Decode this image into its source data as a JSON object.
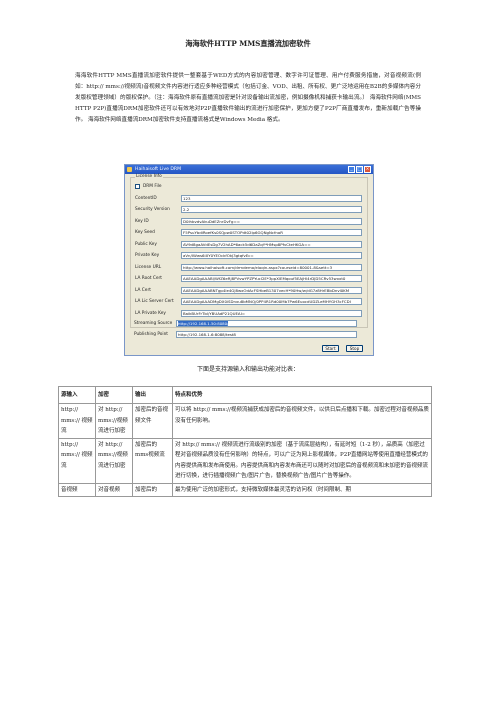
{
  "title": "海海软件HTTP MMS直播流加密软件",
  "intro": "海海软件HTTP MMS直播流加密软件提供一整套基于WED方式的内容加密管理、数字许可证管理、用户付费服务措施，对音视频流(例如：http:// mms://视频流)音视频文件内容进行适应多种经营模式（包括订金、VOD、出租、所有权、更广泛地运用在B2B的多媒体内容分发版权管理领域）的版权保护。（注：海海软件原有直播流加密是针对设备输出流加密，例如摄像机和捕获卡输出流。） 海海软件网络(MMS HTTP P2P)直播流DRM加密软件还可以有效地对P2P直播软件输出的流进行加密保护，更加方便了P2P厂商直播发布，重新加载广告等操作。 海海软件网络直播流DRM加密软件支持直播流格式是Windows Media 格式。",
  "window": {
    "title": "Haihaisoft Live DRM",
    "group_label": "License Info",
    "drm_file_label": "DRM File",
    "fields": [
      {
        "label": "ContentID",
        "value": "123"
      },
      {
        "label": "Security Version",
        "value": "2.2"
      },
      {
        "label": "Key ID",
        "value": "D0ihbvdvAkuDdEZnrDvFg=="
      },
      {
        "label": "Key Seed",
        "value": "F5PsuYbdiRoefKs0SQpw0STOPdt02lp6GQNgNcfnoR"
      },
      {
        "label": "Public Key",
        "value": "AV9d8gaAVdEsDg7V2hAD*6ack5d6DaZqY*HMsp8PfvCteHKGA=="
      },
      {
        "label": "Private Key",
        "value": "aVn/IWws6iXY0YEOckfOkJ3gtqfvEc="
      },
      {
        "label": "License URL",
        "value": "http://www.haihaisoft.com/drmdemo/eloqin.aspx?courseid=80001-8&sett=3"
      },
      {
        "label": "LA Root Cert",
        "value": "AAEAADgAAABl/WfZ6eRJ8PVvwYPZPYucI2E*3ppXlEMqouf5EAjHl4rDJD5CRv53wxxt0"
      },
      {
        "label": "LA Cert",
        "value": "AAEAADgAAABNTgp4le4GJ8wxOdAcFSHbeB1307vecH*90Hw/w/dG7z8HrEBbDnvl0KM"
      },
      {
        "label": "LA Lic Server Cert",
        "value": "AAEAADgAAADMgDX0iSDnxu8bMNQ/0PP4R1Rd00Mb7Pw6EuocdUDZLeMHYGH3cFCDI"
      },
      {
        "label": "LA Private Key",
        "value": "BaikBUrFrTbl/YBUAdP21QUEAI="
      }
    ],
    "streaming_source_label": "Streaming Source",
    "streaming_source_value": "http://192.168.1.50:8080/",
    "publishing_point_label": "Publishing Point",
    "publishing_point_value": "http://192.168.1.6:8088/test8",
    "start_button": "Start",
    "stop_button": "Stop"
  },
  "caption": "下面是支持源输入和输出功能对比表：",
  "table": {
    "headers": [
      "源输入",
      "加密",
      "输出",
      "特点和优势"
    ],
    "rows": [
      [
        "http:// mms:// 视频流",
        "对 http:// mms://视频流进行加密",
        "加密后的音视频文件",
        "可以将 http:// mms://视频流捕获成加密后的音视频文件，以供日后点播和下载。加密过程对音视频品质没有任何影响。"
      ],
      [
        "http:// mms:// 视频流",
        "对 http:// mms://视频流进行加密",
        "加密后的mms视频流",
        "对 http:// mms:// 视频流进行流级别的加密（基于流底层结构），有延时短（1-2 秒），品质高（加密过程对音视频品质没有任何影响）的特点，可以广泛为网上影视媒体，P2P直播网站等使用直播经营模式的内容提供商和发布商使用。内容提供商和内容发布商还可以随时对加密后的音视频流和未加密的音视频流进行切换，进行插播视频广告/图片广告，替换视频广告/图片广告等操作。"
      ],
      [
        "音视频",
        "对音视频",
        "加密后的",
        "最为使用广泛的加密形式，支持微软媒体最灵活的访问权（时间限制、期"
      ]
    ]
  }
}
